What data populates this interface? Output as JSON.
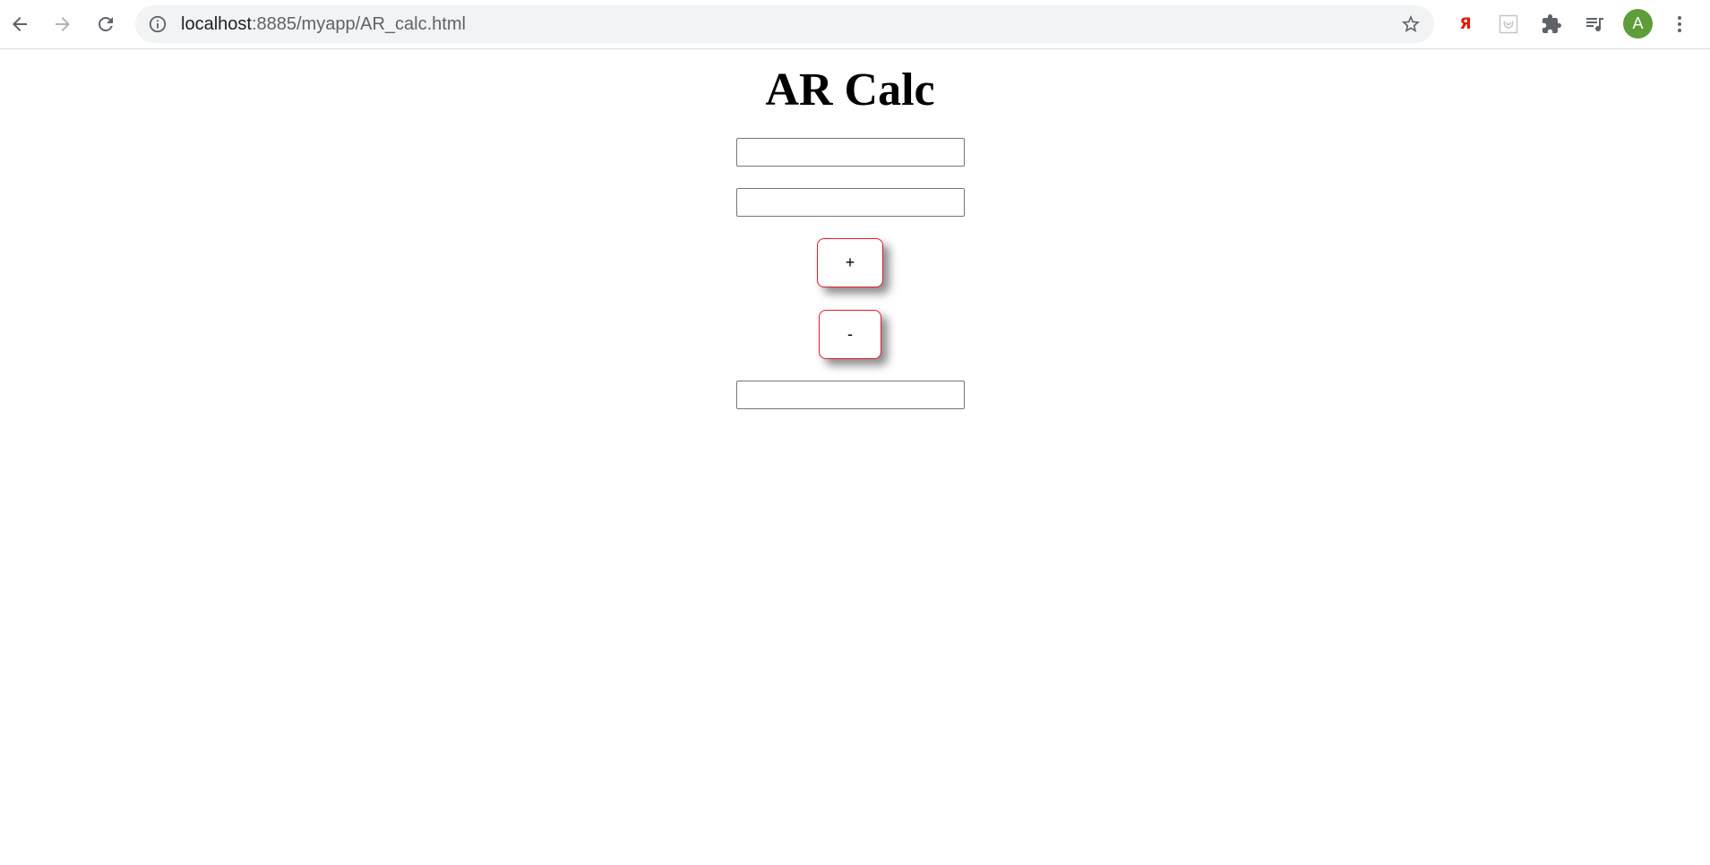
{
  "browser": {
    "url_host": "localhost",
    "url_path": ":8885/myapp/AR_calc.html",
    "avatar_letter": "A",
    "yandex_glyph": "Я",
    "icons": [
      "back-icon",
      "forward-icon",
      "reload-icon",
      "info-icon",
      "star-icon",
      "yandex-icon",
      "pocket-icon",
      "puzzle-icon",
      "playlist-icon",
      "more-icon"
    ],
    "colors": {
      "avatar": "#5e9d3a",
      "yandex": "#e61400",
      "omnibox": "#f1f3f4"
    }
  },
  "page": {
    "title": "AR Calc",
    "first_input": {
      "value": "",
      "placeholder": ""
    },
    "second_input": {
      "value": "",
      "placeholder": ""
    },
    "plus_label": "+",
    "minus_label": "-",
    "result_input": {
      "value": "",
      "placeholder": ""
    },
    "colors": {
      "button_border": "#e0202a"
    }
  }
}
